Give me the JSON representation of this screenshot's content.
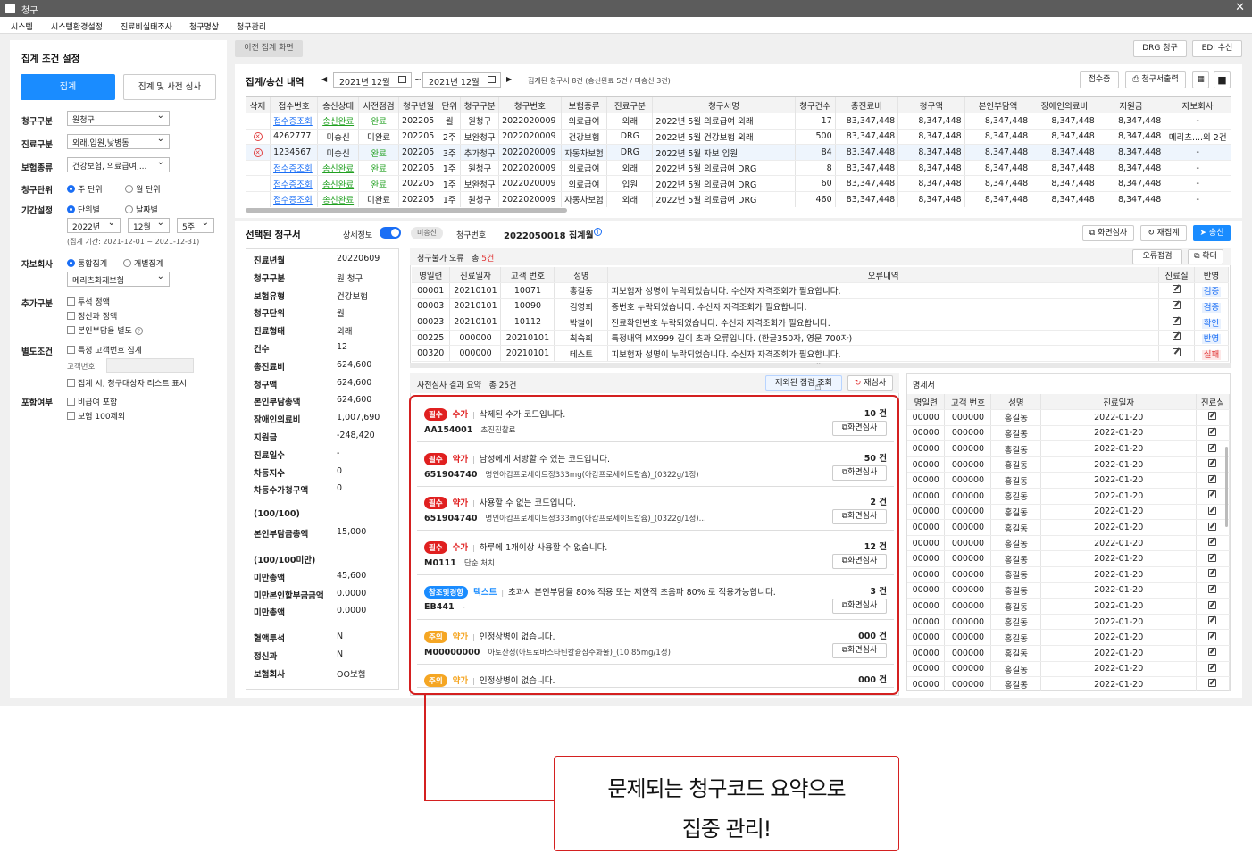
{
  "window": {
    "title": "청구",
    "close": "✕"
  },
  "menu": [
    "시스템",
    "시스템환경설정",
    "진료비실태조사",
    "청구명상",
    "청구관리"
  ],
  "left": {
    "title": "집계 조건 설정",
    "btn_aggregate": "집계",
    "btn_precheck": "집계 및 사전 심사",
    "claim_type_label": "청구구분",
    "claim_type": "원청구",
    "care_type_label": "진료구분",
    "care_type": "외래,입원,낮병동",
    "insurance_label": "보험종류",
    "insurance": "건강보험, 의료급여,...",
    "unit_label": "청구단위",
    "unit_week": "주 단위",
    "unit_month": "월 단위",
    "period_label": "기간설정",
    "period_unit": "단위별",
    "period_date": "날짜별",
    "year": "2022년",
    "month": "12월",
    "week": "5주",
    "period_note": "(집계 기간: 2021-12-01 ~ 2021-12-31)",
    "auto_label": "자보회사",
    "auto_all": "통합집계",
    "auto_each": "개별집계",
    "auto_company": "메리츠화재보험",
    "extra_label": "추가구분",
    "extra1": "투석 정액",
    "extra2": "정신과 정액",
    "extra3": "본인부담율 별도",
    "cond_label": "별도조건",
    "cond1": "특정 고객번호 집계",
    "cond_cust": "고객번호",
    "cond2": "집계 시, 청구대상자 리스트 표시",
    "incl_label": "포함여부",
    "incl1": "비급여 포함",
    "incl2": "보험 100제외"
  },
  "top": {
    "prev_screen": "이전 집계 화면",
    "drg": "DRG 청구",
    "edi": "EDI 수신"
  },
  "list": {
    "title": "집계/송신 내역",
    "from": "2021년 12월",
    "tilde": "~",
    "to": "2021년 12월",
    "summary": "집계된 청구서 8건 (송신완료 5건 / 미송신 3건)",
    "btn_receipt": "접수증",
    "btn_print": "청구서출력",
    "headers": [
      "삭제",
      "접수번호",
      "송신상태",
      "사전점검",
      "청구년월",
      "단위",
      "청구구분",
      "청구번호",
      "보험종류",
      "진료구분",
      "청구서명",
      "청구건수",
      "총진료비",
      "청구액",
      "본인부담액",
      "장애인의료비",
      "지원금",
      "자보회사"
    ],
    "rows": [
      [
        "",
        "접수증조회",
        "송신완료",
        "완료",
        "202205",
        "월",
        "원청구",
        "2022020009",
        "의료급여",
        "외래",
        "2022년 5월 의료급여 외래",
        "17",
        "83,347,448",
        "8,347,448",
        "8,347,448",
        "8,347,448",
        "8,347,448",
        "-"
      ],
      [
        "x",
        "4262777",
        "미송신",
        "미완료",
        "202205",
        "2주",
        "보완청구",
        "2022020009",
        "건강보험",
        "DRG",
        "2022년 5월 건강보험 외래",
        "500",
        "83,347,448",
        "8,347,448",
        "8,347,448",
        "8,347,448",
        "8,347,448",
        "메리츠....외 2건"
      ],
      [
        "x",
        "1234567",
        "미송신",
        "완료",
        "202205",
        "3주",
        "추가청구",
        "2022020009",
        "자동차보험",
        "DRG",
        "2022년 5월 자보 입원",
        "84",
        "83,347,448",
        "8,347,448",
        "8,347,448",
        "8,347,448",
        "8,347,448",
        "-"
      ],
      [
        "",
        "접수증조회",
        "송신완료",
        "완료",
        "202205",
        "1주",
        "원청구",
        "2022020009",
        "의료급여",
        "외래",
        "2022년 5월 의료급여 DRG",
        "8",
        "83,347,448",
        "8,347,448",
        "8,347,448",
        "8,347,448",
        "8,347,448",
        "-"
      ],
      [
        "",
        "접수증조회",
        "송신완료",
        "완료",
        "202205",
        "1주",
        "보완청구",
        "2022020009",
        "의료급여",
        "입원",
        "2022년 5월 의료급여 DRG",
        "60",
        "83,347,448",
        "8,347,448",
        "8,347,448",
        "8,347,448",
        "8,347,448",
        "-"
      ],
      [
        "",
        "접수증조회",
        "송신완료",
        "미완료",
        "202205",
        "1주",
        "원청구",
        "2022020009",
        "자동차보험",
        "외래",
        "2022년 5월 의료급여 DRG",
        "460",
        "83,347,448",
        "8,347,448",
        "8,347,448",
        "8,347,448",
        "8,347,448",
        "-"
      ]
    ]
  },
  "selected": {
    "title": "선택된 청구서",
    "detail": "상세정보",
    "status": "미송신",
    "no_label": "청구번호",
    "no": "2022050018 집계월",
    "btn_review": "화면심사",
    "btn_reagg": "재집계",
    "btn_send": "송신",
    "fields": [
      [
        "진료년월",
        "20220609"
      ],
      [
        "청구구분",
        "원 청구"
      ],
      [
        "보험유형",
        "건강보험"
      ],
      [
        "청구단위",
        "월"
      ],
      [
        "진료형태",
        "외래"
      ],
      [
        "건수",
        "12"
      ],
      [
        "총진료비",
        "624,600"
      ],
      [
        "청구액",
        "624,600"
      ],
      [
        "본인부담총액",
        "624,600"
      ],
      [
        "장애인의료비",
        "1,007,690"
      ],
      [
        "지원금",
        "-248,420"
      ],
      [
        "진료일수",
        "-"
      ],
      [
        "차등지수",
        "0"
      ],
      [
        "차등수가청구액",
        "0"
      ]
    ],
    "fields2": [
      [
        "(100/100)",
        ""
      ],
      [
        "본인부담금총액",
        "15,000"
      ]
    ],
    "fields3": [
      [
        "(100/100미만)",
        ""
      ],
      [
        "미만총액",
        "45,600"
      ],
      [
        "미만본인할부금금액",
        "0.0000"
      ],
      [
        "미만총액",
        "0.0000"
      ]
    ],
    "fields4": [
      [
        "혈액투석",
        "N"
      ],
      [
        "정신과",
        "N"
      ],
      [
        "보험회사",
        "OO보험"
      ]
    ]
  },
  "errors": {
    "title": "청구불가 오류",
    "count_prefix": "총",
    "count": "5건",
    "btn_check": "오류점검",
    "btn_expand": "확대",
    "headers": [
      "명일련",
      "진료일자",
      "고객 번호",
      "성명",
      "오류내역",
      "진료실",
      "반영"
    ],
    "rows": [
      [
        "00001",
        "20210101",
        "10071",
        "홍길동",
        "피보험자 성명이 누락되었습니다. 수신자 자격조회가 필요합니다.",
        "검증"
      ],
      [
        "00003",
        "20210101",
        "10090",
        "김영희",
        "증번호 누락되었습니다. 수신자 자격조회가 필요합니다.",
        "검증"
      ],
      [
        "00023",
        "20210101",
        "10112",
        "박철이",
        "진료확인번호 누락되었습니다. 수신자 자격조회가 필요합니다.",
        "확인"
      ],
      [
        "00225",
        "000000",
        "20210101",
        "최숙희",
        "특정내역 MX999 길이 초과 오류입니다. (한글350자, 영문 700자)",
        "반영"
      ],
      [
        "00320",
        "000000",
        "20210101",
        "테스트",
        "피보험자 성명이 누락되었습니다. 수신자 자격조회가 필요합니다.",
        "실패"
      ]
    ]
  },
  "pre": {
    "title": "사전심사 결과 요약",
    "count": "총 25건",
    "btn_excluded": "제외된 점검 조회",
    "btn_recheck": "재심사",
    "cards": [
      {
        "tag": "필수",
        "tagc": "red",
        "kind": "수가",
        "kc": "red",
        "msg": "삭제된 수가 코드입니다.",
        "code": "AA154001",
        "desc": "초진진찰료",
        "cnt": "10 건",
        "btn": "화면심사"
      },
      {
        "tag": "필수",
        "tagc": "red",
        "kind": "약가",
        "kc": "red",
        "msg": "남성에게 처방할 수 있는 코드입니다.",
        "code": "651904740",
        "desc": "명인아캄프로세이트정333mg(아캄프로세이트칼슘)_(0322g/1정)",
        "cnt": "50 건",
        "btn": "화면심사"
      },
      {
        "tag": "필수",
        "tagc": "red",
        "kind": "약가",
        "kc": "red",
        "msg": "사용할 수 없는 코드입니다.",
        "code": "651904740",
        "desc": "명인아캄프로세이트정333mg(아캄프로세이트칼슘)_(0322g/1정)...",
        "cnt": "2 건",
        "btn": "화면심사"
      },
      {
        "tag": "필수",
        "tagc": "red",
        "kind": "수가",
        "kc": "red",
        "msg": "하루에 1개이상 사용할 수 없습니다.",
        "code": "M0111",
        "desc": "단순 처치",
        "cnt": "12 건",
        "btn": "화면심사"
      },
      {
        "tag": "참조및경향",
        "tagc": "blue",
        "kind": "텍스트",
        "kc": "blue",
        "msg": "초과시 본인부담율 80% 적용 또는 제한적 초음파 80% 로 적용가능합니다.",
        "code": "EB441",
        "desc": "-",
        "cnt": "3 건",
        "btn": "화면심사"
      },
      {
        "tag": "주의",
        "tagc": "orange",
        "kind": "약가",
        "kc": "orange",
        "msg": "인정상병이 없습니다.",
        "code": "M00000000",
        "desc": "아토산정(아트로바스타틴칼슘삼수화물)_(10.85mg/1정)",
        "cnt": "000 건",
        "btn": "화면심사"
      },
      {
        "tag": "주의",
        "tagc": "orange",
        "kind": "약가",
        "kc": "orange",
        "msg": "인정상병이 없습니다.",
        "code": "",
        "desc": "",
        "cnt": "000 건",
        "btn": ""
      }
    ]
  },
  "stmt": {
    "title": "명세서",
    "headers": [
      "명일련",
      "고객 번호",
      "성명",
      "진료일자",
      "진료실"
    ],
    "row": [
      "00000",
      "000000",
      "홍길동",
      "2022-01-20"
    ],
    "rows_count": 18
  },
  "callout": {
    "line1": "문제되는 청구코드 요약으로",
    "line2": "집중 관리!"
  },
  "colors": {
    "accent": "#1a8cff",
    "highlight": "#d42020"
  }
}
